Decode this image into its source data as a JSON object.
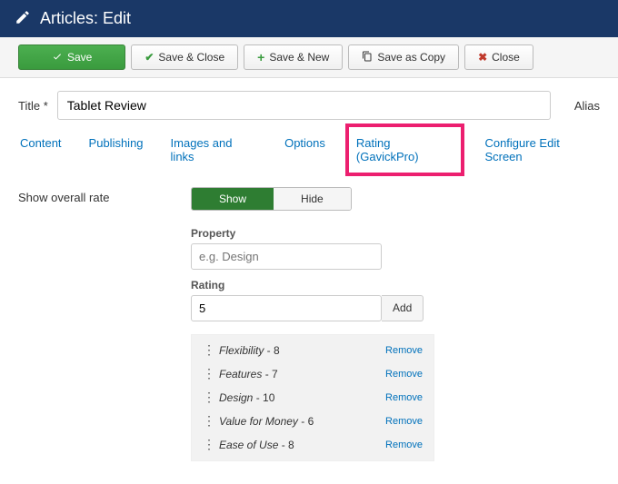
{
  "header": {
    "title": "Articles: Edit"
  },
  "toolbar": {
    "save": "Save",
    "save_close": "Save & Close",
    "save_new": "Save & New",
    "save_copy": "Save as Copy",
    "close": "Close"
  },
  "form": {
    "title_label": "Title *",
    "title_value": "Tablet Review",
    "alias_label": "Alias"
  },
  "tabs": {
    "content": "Content",
    "publishing": "Publishing",
    "images": "Images and links",
    "options": "Options",
    "rating": "Rating (GavickPro)",
    "configure": "Configure Edit Screen"
  },
  "rating_panel": {
    "overall_label": "Show overall rate",
    "show": "Show",
    "hide": "Hide",
    "property_label": "Property",
    "property_placeholder": "e.g. Design",
    "rating_label": "Rating",
    "rating_value": "5",
    "add_label": "Add",
    "remove_label": "Remove",
    "items": [
      {
        "name": "Flexibility",
        "value": "8"
      },
      {
        "name": "Features",
        "value": "7"
      },
      {
        "name": "Design",
        "value": "10"
      },
      {
        "name": "Value for Money",
        "value": "6"
      },
      {
        "name": "Ease of Use",
        "value": "8"
      }
    ]
  }
}
